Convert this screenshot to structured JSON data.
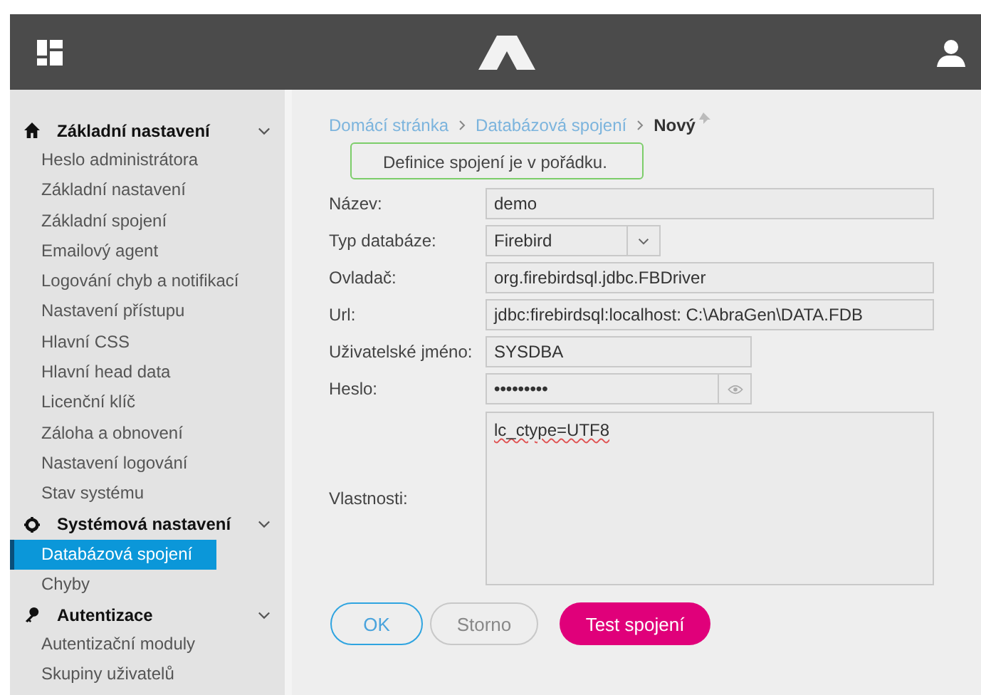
{
  "sidebar": {
    "sections": [
      {
        "label": "Základní nastavení",
        "expanded": true,
        "items": [
          {
            "label": "Heslo administrátora",
            "selected": false
          },
          {
            "label": "Základní nastavení",
            "selected": false
          },
          {
            "label": "Základní spojení",
            "selected": false
          },
          {
            "label": "Emailový agent",
            "selected": false
          },
          {
            "label": "Logování chyb a notifikací",
            "selected": false
          },
          {
            "label": "Nastavení přístupu",
            "selected": false
          },
          {
            "label": "Hlavní CSS",
            "selected": false
          },
          {
            "label": "Hlavní head data",
            "selected": false
          },
          {
            "label": "Licenční klíč",
            "selected": false
          },
          {
            "label": "Záloha a obnovení",
            "selected": false
          },
          {
            "label": "Nastavení logování",
            "selected": false
          },
          {
            "label": "Stav systému",
            "selected": false
          }
        ]
      },
      {
        "label": "Systémová nastavení",
        "expanded": true,
        "items": [
          {
            "label": "Databázová spojení",
            "selected": true
          },
          {
            "label": "Chyby",
            "selected": false
          }
        ]
      },
      {
        "label": "Autentizace",
        "expanded": true,
        "items": [
          {
            "label": "Autentizační moduly",
            "selected": false
          },
          {
            "label": "Skupiny uživatelů",
            "selected": false
          }
        ]
      }
    ]
  },
  "breadcrumb": {
    "links": [
      "Domácí stránka",
      "Databázová spojení"
    ],
    "current": "Nový"
  },
  "toast": "Definice spojení je v pořádku.",
  "form": {
    "fields": [
      {
        "kind": "text",
        "label": "Název:",
        "value": "demo"
      },
      {
        "kind": "select",
        "label": "Typ databáze:",
        "value": "Firebird"
      },
      {
        "kind": "text",
        "label": "Ovladač:",
        "value": "org.firebirdsql.jdbc.FBDriver"
      },
      {
        "kind": "text",
        "label": "Url:",
        "value": "jdbc:firebirdsql:localhost: C:\\AbraGen\\DATA.FDB"
      },
      {
        "kind": "short_text",
        "label": "Uživatelské jméno:",
        "value": "SYSDBA"
      },
      {
        "kind": "password",
        "label": "Heslo:",
        "value": "•••••••••"
      },
      {
        "kind": "textarea",
        "label": "Vlastnosti:",
        "value": "lc_ctype=UTF8"
      }
    ]
  },
  "buttons": [
    {
      "kind": "ok",
      "label": "OK"
    },
    {
      "kind": "cancel",
      "label": "Storno"
    },
    {
      "kind": "primary",
      "label": "Test spojení"
    }
  ]
}
